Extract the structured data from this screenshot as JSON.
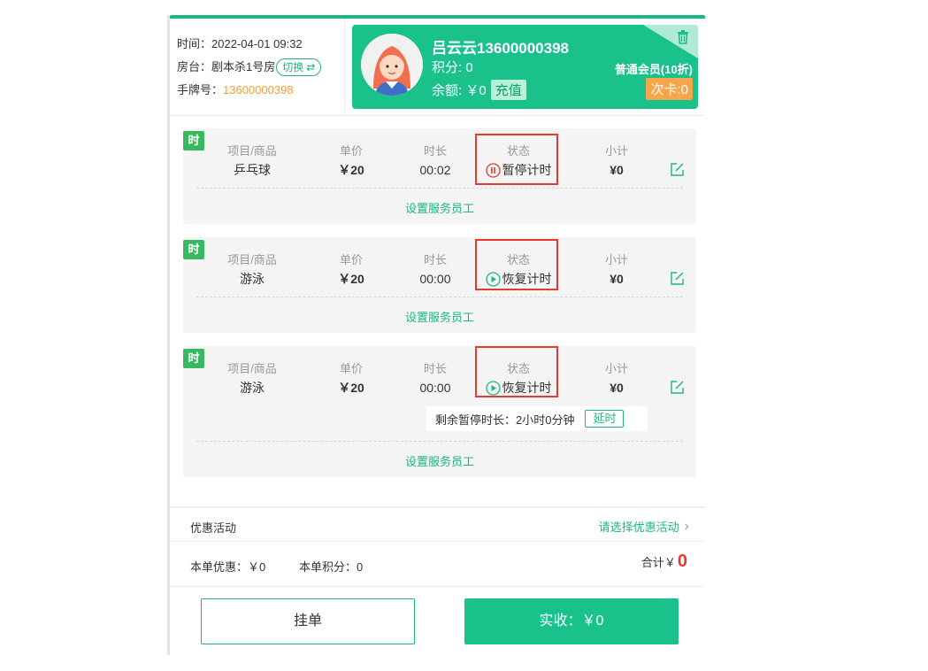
{
  "order": {
    "time_label": "时间：",
    "time_value": "2022-04-01 09:32",
    "room_label": "房台：",
    "room_value": "剧本杀1号房",
    "switch_label": "切换",
    "tag_label": "手牌号：",
    "tag_value": "13600000398"
  },
  "member": {
    "name": "吕云云13600000398",
    "points": "积分: 0",
    "balance": "余额: ￥0",
    "recharge_label": "充值",
    "level": "普通会员(10折)",
    "card_label": "次卡:0"
  },
  "columns": {
    "item": "项目/商品",
    "price": "单价",
    "duration": "时长",
    "status": "状态",
    "subtotal": "小计"
  },
  "items": [
    {
      "tag": "时",
      "name": "乒乓球",
      "price": "￥20",
      "duration": "00:02",
      "status": "暂停计时",
      "status_icon": "pause-circle-icon",
      "subtotal": "¥0",
      "staff_label": "设置服务员工"
    },
    {
      "tag": "时",
      "name": "游泳",
      "price": "￥20",
      "duration": "00:00",
      "status": "恢复计时",
      "status_icon": "play-circle-icon",
      "subtotal": "¥0",
      "staff_label": "设置服务员工"
    },
    {
      "tag": "时",
      "name": "游泳",
      "price": "￥20",
      "duration": "00:00",
      "status": "恢复计时",
      "status_icon": "play-circle-icon",
      "subtotal": "¥0",
      "staff_label": "设置服务员工",
      "pause_remaining": "剩余暂停时长：2小时0分钟",
      "extend_label": "延时"
    }
  ],
  "promo": {
    "label": "优惠活动",
    "select_label": "请选择优惠活动"
  },
  "summary": {
    "discount": "本单优惠：￥0",
    "points": "本单积分：0",
    "total_label": "合计￥",
    "total_value": "0"
  },
  "actions": {
    "hold_label": "挂单",
    "pay_label": "实收：￥0"
  },
  "colors": {
    "primary": "#1ac18a",
    "accent_orange": "#f0a030",
    "highlight_red": "#e53a2f",
    "tag_green": "#38b861"
  }
}
